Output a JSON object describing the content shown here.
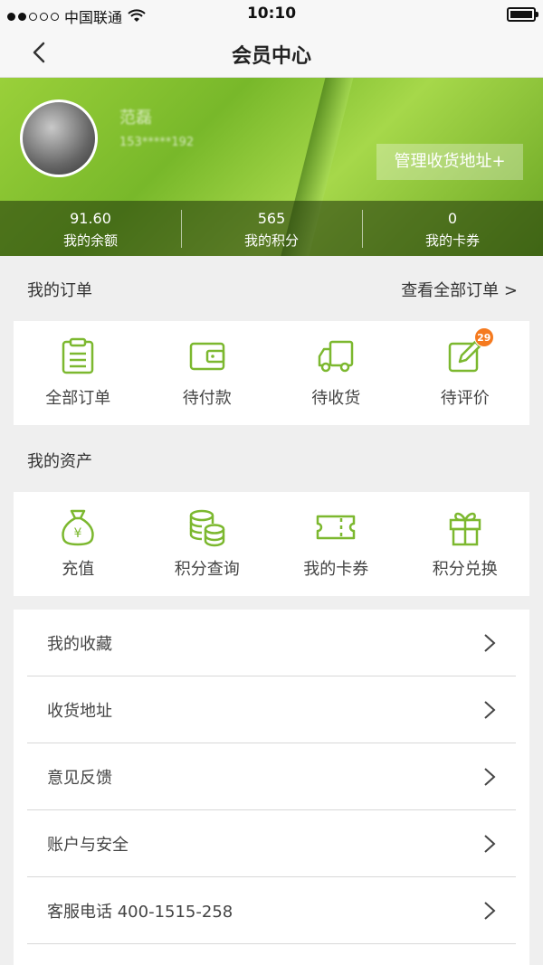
{
  "status_bar": {
    "carrier": "中国联通",
    "time": "10:10"
  },
  "nav": {
    "title": "会员中心"
  },
  "profile": {
    "name": "范磊",
    "phone": "153*****192",
    "address_button": "管理收货地址+",
    "stats": [
      {
        "value": "91.60",
        "label": "我的余额"
      },
      {
        "value": "565",
        "label": "我的积分"
      },
      {
        "value": "0",
        "label": "我的卡券"
      }
    ]
  },
  "orders": {
    "title": "我的订单",
    "view_all": "查看全部订单 >",
    "items": [
      {
        "label": "全部订单",
        "icon": "clipboard-icon"
      },
      {
        "label": "待付款",
        "icon": "wallet-icon"
      },
      {
        "label": "待收货",
        "icon": "truck-icon"
      },
      {
        "label": "待评价",
        "icon": "edit-icon",
        "badge": "29"
      }
    ]
  },
  "assets": {
    "title": "我的资产",
    "items": [
      {
        "label": "充值",
        "icon": "money-bag-icon"
      },
      {
        "label": "积分查询",
        "icon": "coin-stack-icon"
      },
      {
        "label": "我的卡券",
        "icon": "ticket-icon"
      },
      {
        "label": "积分兑换",
        "icon": "gift-icon"
      }
    ]
  },
  "menu": [
    {
      "label": "我的收藏"
    },
    {
      "label": "收货地址"
    },
    {
      "label": "意见反馈"
    },
    {
      "label": "账户与安全"
    },
    {
      "label": "客服电话 400-1515-258"
    }
  ],
  "colors": {
    "accent": "#7cb82f",
    "badge": "#f57a1f"
  }
}
